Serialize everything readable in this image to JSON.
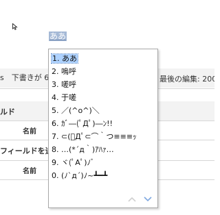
{
  "composition": {
    "text": "ああ"
  },
  "page": {
    "draft_info": "s　下書きが 6",
    "last_edit": "最後の編集: 200",
    "field_section": "ルド",
    "name_label_1": "名前",
    "add_field": "フィールドを追加",
    "name_label_2": "名前"
  },
  "candidates": {
    "items": [
      "1. ああ",
      "2. 嗚呼",
      "3. 嗟呼",
      "4. 于嗟",
      "5. ／(^o^)＼",
      "6. ｶﾞ―(ﾟДﾟ)―ﾝ!!",
      "7. ⊂(ﾟДﾟ⊂⌒｀つ≡≡≡ｯ",
      "8. …(*´д｀)ｱﾊｧ…",
      "9. ヾ(ﾟAﾟ)ﾉﾞ",
      "0. (ﾉ`д´)ﾉ~┻━┻"
    ],
    "selected_index": 0
  },
  "icons": {
    "cursor": "mouse-pointer-icon",
    "up": "chevron-up-icon",
    "down": "chevron-down-icon"
  },
  "colors": {
    "selection": "#aed2ff",
    "composition_bg": "#a5b9d6",
    "down_arrow": "#7fa8e0",
    "up_arrow": "#d0d0d0"
  }
}
